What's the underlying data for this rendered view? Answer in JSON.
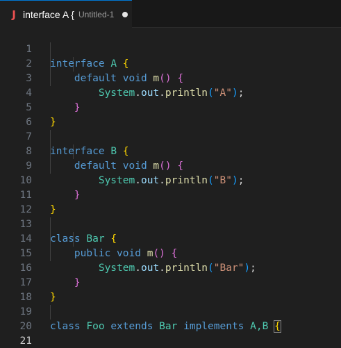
{
  "tab": {
    "icon": "J",
    "title": "interface A {",
    "description": "Untitled-1",
    "dirty_icon": "dirty-dot-icon"
  },
  "line_numbers": [
    "1",
    "2",
    "3",
    "4",
    "5",
    "6",
    "7",
    "8",
    "9",
    "10",
    "11",
    "12",
    "13",
    "14",
    "15",
    "16",
    "17",
    "18",
    "19",
    "20",
    "21"
  ],
  "active_line": "21",
  "code": {
    "l1": {
      "kw": "interface",
      "name": "A",
      "brace": "{"
    },
    "l2": {
      "mod": "default",
      "ret": "void",
      "fn": "m",
      "paren": "()",
      "brace": "{"
    },
    "l3": {
      "obj": "System",
      "dot1": ".",
      "field": "out",
      "dot2": ".",
      "fn": "println",
      "lp": "(",
      "str": "\"A\"",
      "rp": ")",
      "semi": ";"
    },
    "l4": {
      "brace": "}"
    },
    "l5": {
      "brace": "}"
    },
    "l7": {
      "kw": "interface",
      "name": "B",
      "brace": "{"
    },
    "l8": {
      "mod": "default",
      "ret": "void",
      "fn": "m",
      "paren": "()",
      "brace": "{"
    },
    "l9": {
      "obj": "System",
      "dot1": ".",
      "field": "out",
      "dot2": ".",
      "fn": "println",
      "lp": "(",
      "str": "\"B\"",
      "rp": ")",
      "semi": ";"
    },
    "l10": {
      "brace": "}"
    },
    "l11": {
      "brace": "}"
    },
    "l13": {
      "kw": "class",
      "name": "Bar",
      "brace": "{"
    },
    "l14": {
      "mod": "public",
      "ret": "void",
      "fn": "m",
      "paren": "()",
      "brace": "{"
    },
    "l15": {
      "obj": "System",
      "dot1": ".",
      "field": "out",
      "dot2": ".",
      "fn": "println",
      "lp": "(",
      "str": "\"Bar\"",
      "rp": ")",
      "semi": ";"
    },
    "l16": {
      "brace": "}"
    },
    "l17": {
      "brace": "}"
    },
    "l19": {
      "kw": "class",
      "name": "Foo",
      "ext": "extends",
      "parent": "Bar",
      "impl": "implements",
      "ifaces": "A,B",
      "brace": "{"
    },
    "l21": {
      "brace": "}"
    }
  },
  "colors": {
    "background": "#1f1f1f",
    "keyword": "#569cd6",
    "type": "#4ec9b0",
    "function": "#dcdcaa",
    "string": "#ce9178",
    "bracket_level1": "#ffd700",
    "bracket_level2": "#da70d6",
    "java_icon": "#f05252"
  }
}
